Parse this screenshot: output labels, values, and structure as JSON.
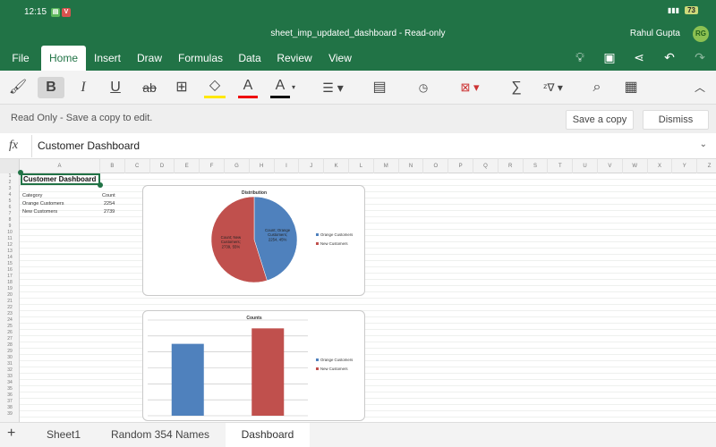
{
  "status": {
    "time": "12:15",
    "battery": "73",
    "signal": "Vo LTE"
  },
  "title_bar": {
    "doc_title": "sheet_imp_updated_dashboard - Read-only",
    "user_name": "Rahul Gupta",
    "user_initials": "RG"
  },
  "ribbon_tabs": [
    "File",
    "Home",
    "Insert",
    "Draw",
    "Formulas",
    "Data",
    "Review",
    "View"
  ],
  "toolbar": {
    "bold": "B",
    "italic": "I",
    "underline": "U",
    "strike": "ab",
    "text_color_letter": "A",
    "sum": "∑"
  },
  "read_only_bar": {
    "message": "Read Only - Save a copy to edit.",
    "save_copy": "Save a copy",
    "dismiss": "Dismiss"
  },
  "formula_bar": {
    "fx": "fx",
    "value": "Customer Dashboard"
  },
  "columns": [
    "A",
    "B",
    "C",
    "D",
    "E",
    "F",
    "G",
    "H",
    "I",
    "J",
    "K",
    "L",
    "M",
    "N",
    "O",
    "P",
    "Q",
    "R",
    "S",
    "T",
    "U",
    "V",
    "W",
    "X",
    "Y",
    "Z"
  ],
  "rows": [
    "1",
    "2",
    "3",
    "4",
    "5",
    "6",
    "7",
    "8",
    "9",
    "10",
    "11",
    "12",
    "13",
    "14",
    "15",
    "16",
    "17",
    "18",
    "19",
    "20",
    "21",
    "22",
    "23",
    "24",
    "25",
    "26",
    "27",
    "28",
    "29",
    "30",
    "31",
    "32",
    "33",
    "34",
    "35",
    "36",
    "37",
    "38",
    "39"
  ],
  "cells": {
    "a1": "Customer Dashboard",
    "header_category": "Category",
    "header_count": "Count",
    "rows": [
      {
        "category": "Orange Customers",
        "count": "2254"
      },
      {
        "category": "New Customers",
        "count": "2739"
      }
    ]
  },
  "chart_data": [
    {
      "type": "pie",
      "title": "Distribution",
      "categories": [
        "Orange Customers",
        "New Customers"
      ],
      "values": [
        2254,
        2739
      ],
      "data_labels": [
        "Count; Orange Customers; 2254; 45%",
        "Count; New Customers; 2739; 55%"
      ],
      "colors": [
        "#4f81bd",
        "#c0504d"
      ],
      "legend": "right"
    },
    {
      "type": "bar",
      "title": "Counts",
      "categories": [
        "Orange Customers",
        "New Customers"
      ],
      "values": [
        2254,
        2739
      ],
      "ylim": [
        0,
        3000
      ],
      "grid": true,
      "colors": [
        "#4f81bd",
        "#c0504d"
      ],
      "legend": "right"
    }
  ],
  "sheet_tabs": [
    "Sheet1",
    "Random 354 Names",
    "Dashboard"
  ],
  "active_sheet": "Dashboard",
  "colors": {
    "excel_green": "#217346",
    "pie_blue": "#4f81bd",
    "pie_red": "#c0504d"
  }
}
